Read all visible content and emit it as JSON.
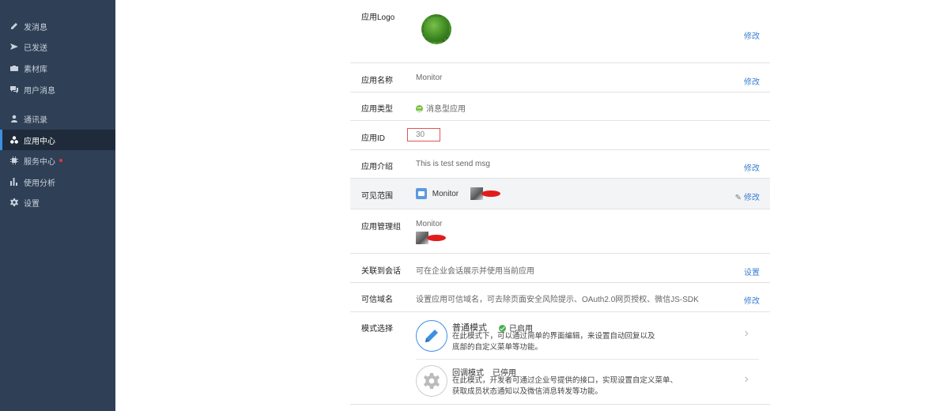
{
  "sidebar": {
    "items": [
      {
        "label": "发消息",
        "icon": "pencil-icon"
      },
      {
        "label": "已发送",
        "icon": "send-icon"
      },
      {
        "label": "素材库",
        "icon": "briefcase-icon"
      },
      {
        "label": "用户消息",
        "icon": "chat-icon"
      },
      {
        "label": "通讯录",
        "icon": "user-icon"
      },
      {
        "label": "应用中心",
        "icon": "apps-icon",
        "active": true
      },
      {
        "label": "服务中心",
        "icon": "gear-chip-icon",
        "badge": "red-dot"
      },
      {
        "label": "使用分析",
        "icon": "bar-chart-icon"
      },
      {
        "label": "设置",
        "icon": "settings-icon"
      }
    ]
  },
  "app": {
    "logo": {
      "label": "应用Logo",
      "action": "修改"
    },
    "name": {
      "label": "应用名称",
      "value": "Monitor",
      "action": "修改"
    },
    "type": {
      "label": "应用类型",
      "value": "消息型应用"
    },
    "id": {
      "label": "应用ID",
      "value": "30"
    },
    "intro": {
      "label": "应用介绍",
      "value": "This is test send msg",
      "action": "修改"
    },
    "scope": {
      "label": "可见范围",
      "value": "Monitor",
      "action": "修改"
    },
    "admin": {
      "label": "应用管理组",
      "value": "Monitor"
    },
    "session": {
      "label": "关联到会话",
      "value": "可在企业会话展示并使用当前应用",
      "action": "设置"
    },
    "domain": {
      "label": "可信域名",
      "value": "设置应用可信域名，可去除页面安全风险提示、OAuth2.0网页授权、微信JS-SDK",
      "action": "修改"
    },
    "mode": {
      "label": "模式选择",
      "normal": {
        "title": "普通模式",
        "status": "已启用",
        "desc": "在此模式下，可以通过简单的界面编辑，来设置自动回复以及底部的自定义菜单等功能。"
      },
      "callback": {
        "title": "回调模式",
        "status": "已停用",
        "desc": "在此模式，开发者可通过企业号提供的接口，实现设置自定义菜单、获取成员状态通知以及微信消息转发等功能。"
      }
    }
  },
  "colors": {
    "sidebar_bg": "#2f3f55",
    "link": "#3b7fd1",
    "accent": "#3d8fe0"
  }
}
